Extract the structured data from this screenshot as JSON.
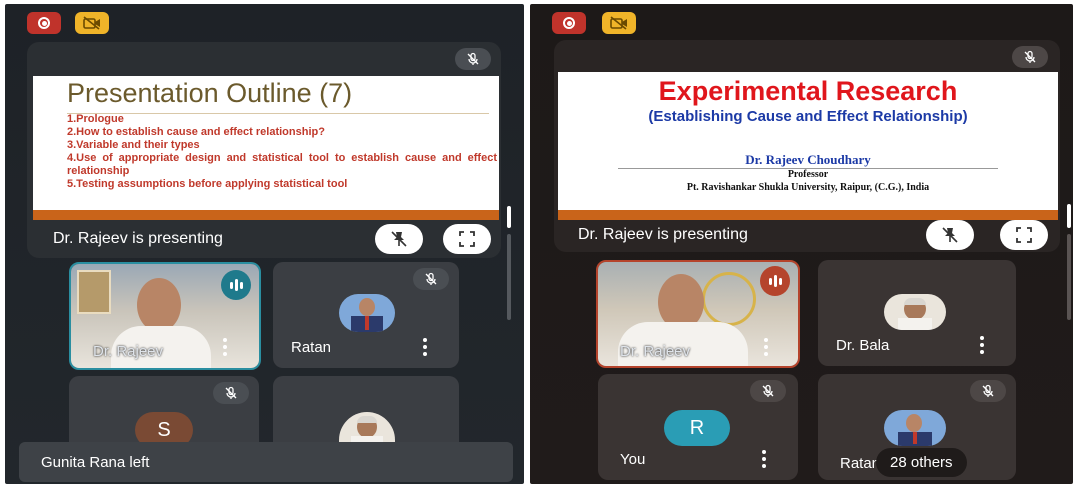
{
  "left": {
    "slide": {
      "title": "Presentation Outline (7)",
      "items": [
        "1.Prologue",
        "2.How to establish cause and effect relationship?",
        "3.Variable and their types",
        "4.Use of appropriate design and statistical tool to establish cause and effect relationship",
        "5.Testing assumptions before applying statistical tool"
      ]
    },
    "presenting_text": "Dr. Rajeev is presenting",
    "tiles": [
      {
        "name": "Dr. Rajeev"
      },
      {
        "name": "Ratan"
      },
      {
        "name": "S"
      },
      {
        "name": ""
      }
    ],
    "toast": "Gunita Rana left"
  },
  "right": {
    "slide": {
      "title": "Experimental Research",
      "subtitle": "(Establishing Cause and Effect Relationship)",
      "author": "Dr. Rajeev Choudhary",
      "role": "Professor",
      "affiliation": "Pt. Ravishankar Shukla University, Raipur, (C.G.), India"
    },
    "presenting_text": "Dr. Rajeev is presenting",
    "tiles": [
      {
        "name": "Dr. Rajeev"
      },
      {
        "name": "Dr. Bala"
      },
      {
        "name": "You",
        "initial": "R"
      },
      {
        "name": "Ratan"
      }
    ],
    "others_label": "28 others"
  },
  "colors": {
    "record": "#c0332b",
    "camera_off": "#f0b429",
    "slide_title_left": "#6b5a2c",
    "slide_items_left": "#c0392b",
    "slide_title_right": "#e0161c",
    "slide_subtitle_right": "#1c3aa6",
    "speaking_left": "#1f7a8c",
    "speaking_right": "#b5442c",
    "avatar_s": "#7a4a34",
    "avatar_r": "#2a9db5"
  }
}
